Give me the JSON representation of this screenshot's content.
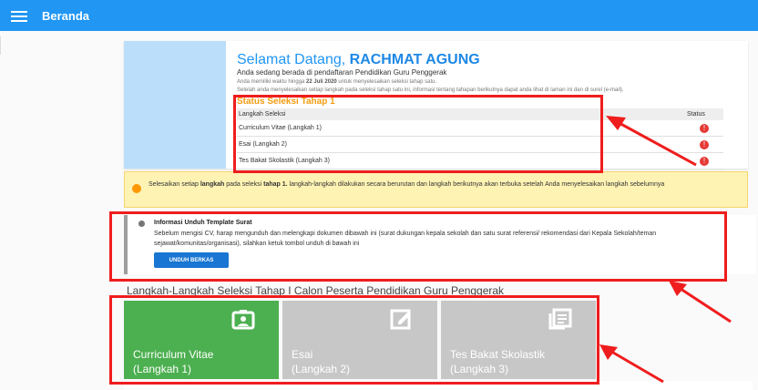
{
  "header": {
    "title": "Beranda",
    "menu_icon": "menu-icon"
  },
  "welcome": {
    "greeting": "Selamat Datang,",
    "name": "RACHMAT AGUNG",
    "subtitle": "Anda sedang berada di pendaftaran Pendidikan Guru Penggerak",
    "time_prefix": "Anda memiliki waktu hingga",
    "deadline": "22 Juli 2020",
    "time_suffix": "untuk menyelesaikan seleksi tahap satu.",
    "note": "Setelah anda menyelesaikan setiap langkah pada seleksi tahap satu ini, informasi tentang tahapan berikutnya dapat anda lihat di laman ini dan di surel (e-mail)."
  },
  "status": {
    "title": "Status Seleksi Tahap 1",
    "headers": [
      "Langkah Seleksi",
      "Status"
    ],
    "rows": [
      {
        "step": "Curriculum Vitae (Langkah 1)",
        "status": "!"
      },
      {
        "step": "Esai (Langkah 2)",
        "status": "!"
      },
      {
        "step": "Tes Bakat Skolastik (Langkah 3)",
        "status": "!"
      }
    ]
  },
  "alert": {
    "text_1": "Selesaikan setiap",
    "bold_1": "langkah",
    "text_2": "pada seleksi",
    "bold_2": "tahap 1.",
    "text_3": "langkah-langkah dilakukan secara berurutan dan langkah berikutnya akan terbuka setelah Anda menyelesaikan langkah sebelumnya"
  },
  "download": {
    "title": "Informasi Unduh Template Surat",
    "text": "Sebelum mengisi CV, harap mengunduh dan melengkapi dokumen dibawah ini (surat dukungan kepala sekolah dan satu surat referensi/ rekomendasi dari Kepala Sekolah/teman sejawat/komunitas/organisasi), silahkan ketuk tombol unduh di bawah ini",
    "button": "UNDUH BERKAS"
  },
  "steps": {
    "title": "Langkah-Langkah Seleksi Tahap I Calon Peserta Pendidikan Guru Penggerak",
    "items": [
      {
        "title": "Curriculum Vitae",
        "subtitle": "(Langkah 1)",
        "icon": "id-badge-icon",
        "color": "#4caf50"
      },
      {
        "title": "Esai",
        "subtitle": "(Langkah 2)",
        "icon": "edit-icon",
        "color": "#c7c7c7"
      },
      {
        "title": "Tes Bakat Skolastik",
        "subtitle": "(Langkah 3)",
        "icon": "document-icon",
        "color": "#c7c7c7"
      }
    ]
  },
  "colors": {
    "accent": "#2196f3",
    "success": "#4caf50",
    "warning": "#ff9800",
    "error": "#e53935",
    "highlight": "#ef1d1d"
  }
}
